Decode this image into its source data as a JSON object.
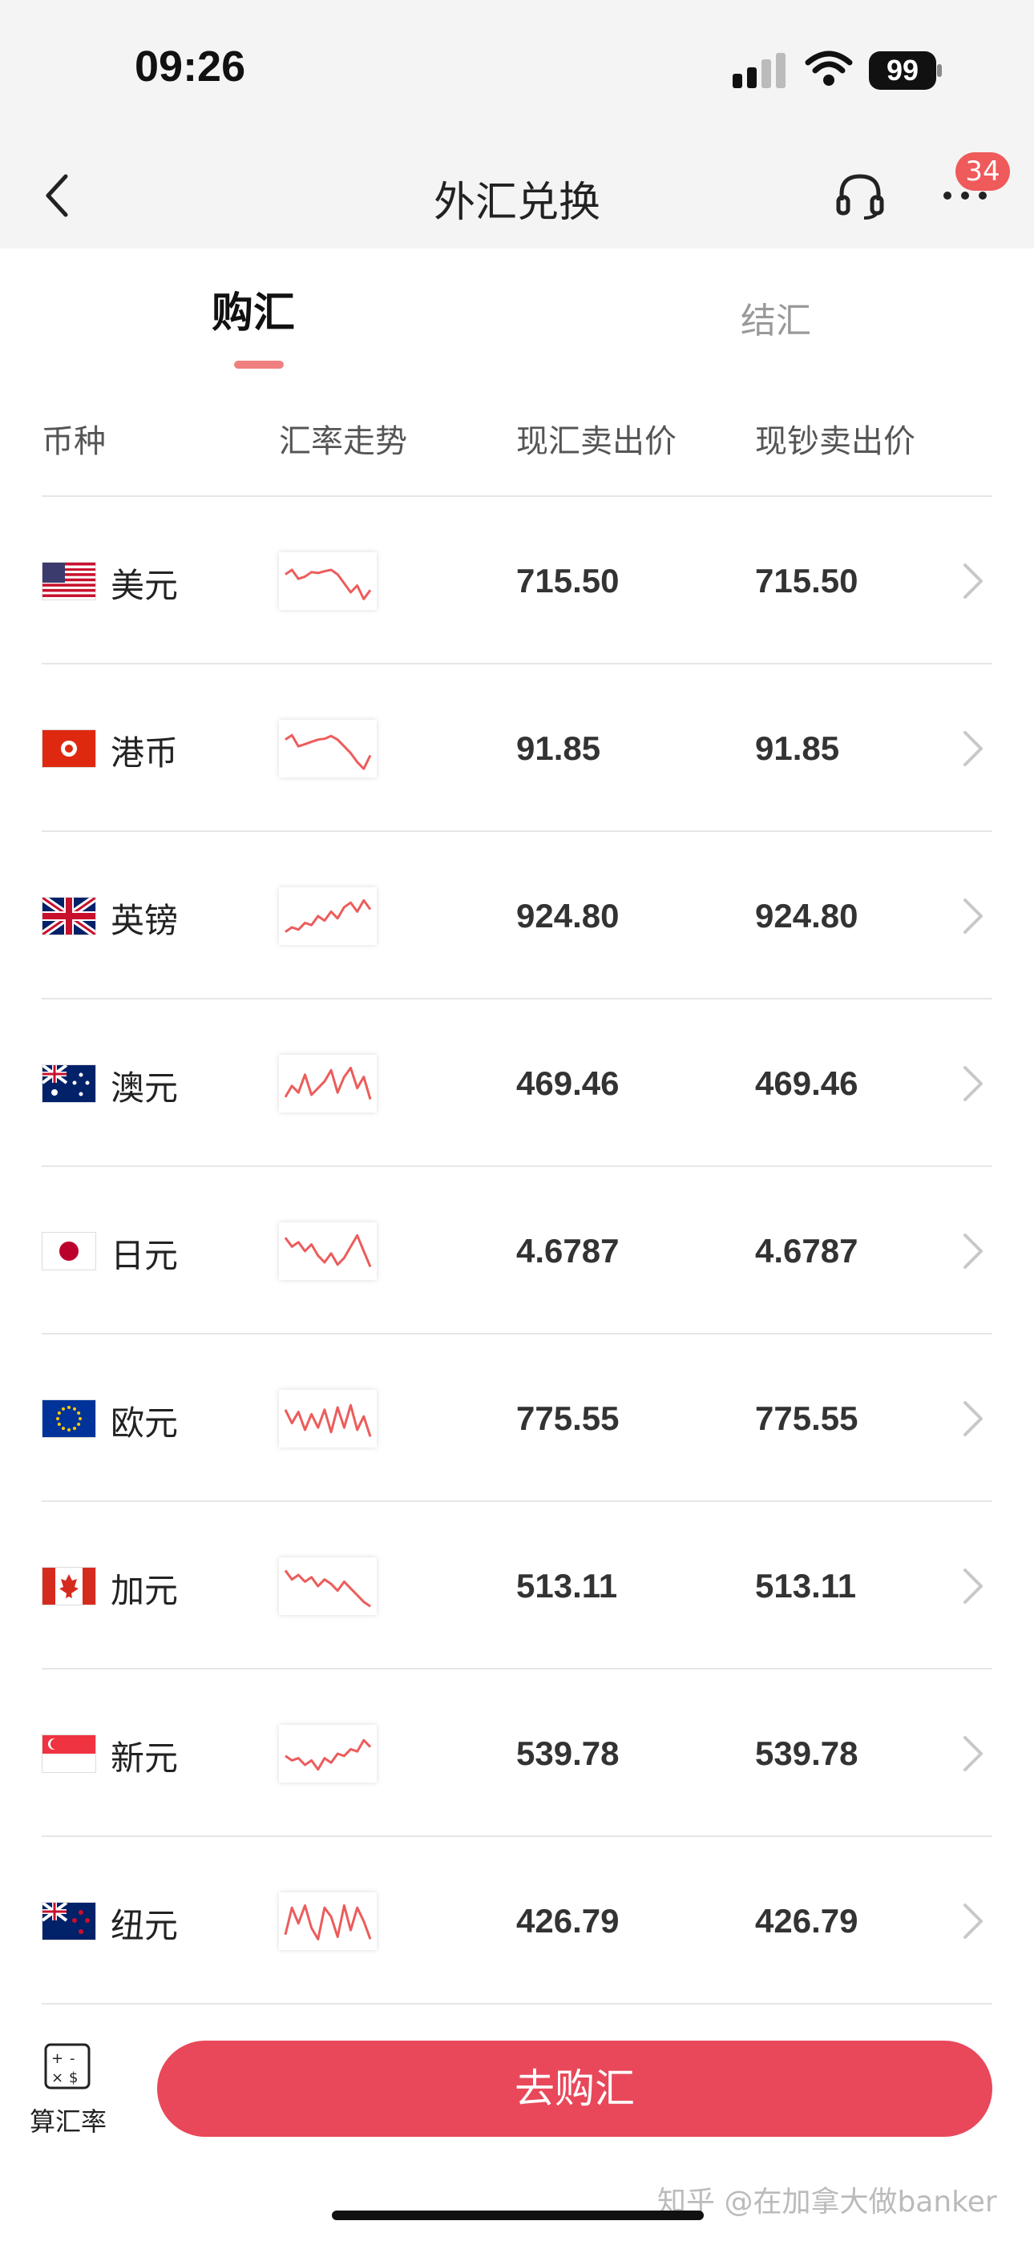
{
  "status_bar": {
    "time": "09:26",
    "battery": "99"
  },
  "nav": {
    "title": "外汇兑换",
    "badge": "34"
  },
  "tabs": [
    {
      "label": "购汇",
      "active": true
    },
    {
      "label": "结汇",
      "active": false
    }
  ],
  "table": {
    "headers": [
      "币种",
      "汇率走势",
      "现汇卖出价",
      "现钞卖出价"
    ],
    "rows": [
      {
        "currency": "美元",
        "flag": "us-flag",
        "spot": "715.50",
        "cash": "715.50",
        "trend": [
          0.35,
          0.25,
          0.45,
          0.4,
          0.3,
          0.32,
          0.28,
          0.25,
          0.35,
          0.55,
          0.75,
          0.6,
          0.9,
          0.7
        ]
      },
      {
        "currency": "港币",
        "flag": "hk-flag",
        "spot": "91.85",
        "cash": "91.85",
        "trend": [
          0.3,
          0.2,
          0.45,
          0.4,
          0.35,
          0.3,
          0.28,
          0.22,
          0.3,
          0.45,
          0.6,
          0.8,
          0.95,
          0.65
        ]
      },
      {
        "currency": "英镑",
        "flag": "gb-flag",
        "spot": "924.80",
        "cash": "924.80",
        "trend": [
          0.85,
          0.75,
          0.8,
          0.65,
          0.7,
          0.5,
          0.6,
          0.4,
          0.55,
          0.3,
          0.2,
          0.4,
          0.15,
          0.35
        ]
      },
      {
        "currency": "澳元",
        "flag": "au-flag",
        "spot": "469.46",
        "cash": "469.46",
        "trend": [
          0.8,
          0.55,
          0.7,
          0.3,
          0.75,
          0.6,
          0.45,
          0.2,
          0.7,
          0.35,
          0.15,
          0.6,
          0.35,
          0.85
        ]
      },
      {
        "currency": "日元",
        "flag": "jp-flag",
        "spot": "4.6787",
        "cash": "4.6787",
        "trend": [
          0.2,
          0.4,
          0.3,
          0.5,
          0.35,
          0.6,
          0.75,
          0.55,
          0.8,
          0.65,
          0.4,
          0.15,
          0.5,
          0.85
        ]
      },
      {
        "currency": "欧元",
        "flag": "eu-flag",
        "spot": "775.55",
        "cash": "775.55",
        "trend": [
          0.3,
          0.6,
          0.35,
          0.75,
          0.4,
          0.7,
          0.3,
          0.8,
          0.25,
          0.7,
          0.2,
          0.75,
          0.45,
          0.9
        ]
      },
      {
        "currency": "加元",
        "flag": "ca-flag",
        "spot": "513.11",
        "cash": "513.11",
        "trend": [
          0.15,
          0.35,
          0.25,
          0.4,
          0.3,
          0.5,
          0.35,
          0.45,
          0.6,
          0.4,
          0.55,
          0.7,
          0.85,
          0.95
        ]
      },
      {
        "currency": "新元",
        "flag": "sg-flag",
        "spot": "539.78",
        "cash": "539.78",
        "trend": [
          0.55,
          0.65,
          0.6,
          0.75,
          0.65,
          0.85,
          0.6,
          0.7,
          0.5,
          0.55,
          0.4,
          0.45,
          0.2,
          0.35
        ]
      },
      {
        "currency": "纽元",
        "flag": "nz-flag",
        "spot": "426.79",
        "cash": "426.79",
        "trend": [
          0.8,
          0.2,
          0.55,
          0.15,
          0.65,
          0.9,
          0.2,
          0.4,
          0.85,
          0.15,
          0.7,
          0.2,
          0.5,
          0.9
        ]
      }
    ]
  },
  "bottom": {
    "calc_label": "算汇率",
    "buy_label": "去购汇"
  },
  "watermark": "知乎 @在加拿大做banker",
  "colors": {
    "accent": "#e8485a",
    "trend_line": "#ec5c5c",
    "badge": "#ef5a5a"
  }
}
